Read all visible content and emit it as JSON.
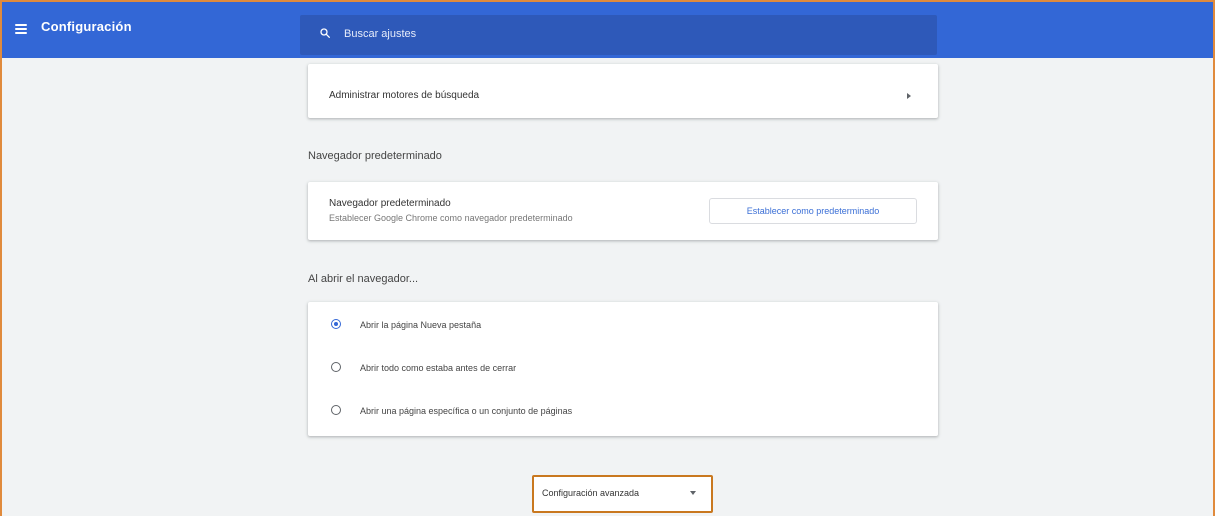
{
  "header": {
    "title": "Configuración",
    "search_placeholder": "Buscar ajustes"
  },
  "search_engines": {
    "manage_label": "Administrar motores de búsqueda"
  },
  "default_browser": {
    "section_title": "Navegador predeterminado",
    "primary": "Navegador predeterminado",
    "secondary": "Establecer Google Chrome como navegador predeterminado",
    "button_label": "Establecer como predeterminado"
  },
  "on_startup": {
    "section_title": "Al abrir el navegador...",
    "options": [
      {
        "label": "Abrir la página Nueva pestaña",
        "selected": true
      },
      {
        "label": "Abrir todo como estaba antes de cerrar",
        "selected": false
      },
      {
        "label": "Abrir una página específica o un conjunto de páginas",
        "selected": false
      }
    ]
  },
  "advanced": {
    "label": "Configuración avanzada"
  },
  "colors": {
    "header_blue": "#3367d6",
    "search_bg": "#2e59b9",
    "highlight_orange": "#c9781f",
    "link_blue": "#3b6fd6"
  },
  "icons": [
    "menu-icon",
    "search-icon",
    "chevron-right-icon",
    "chevron-down-icon"
  ]
}
